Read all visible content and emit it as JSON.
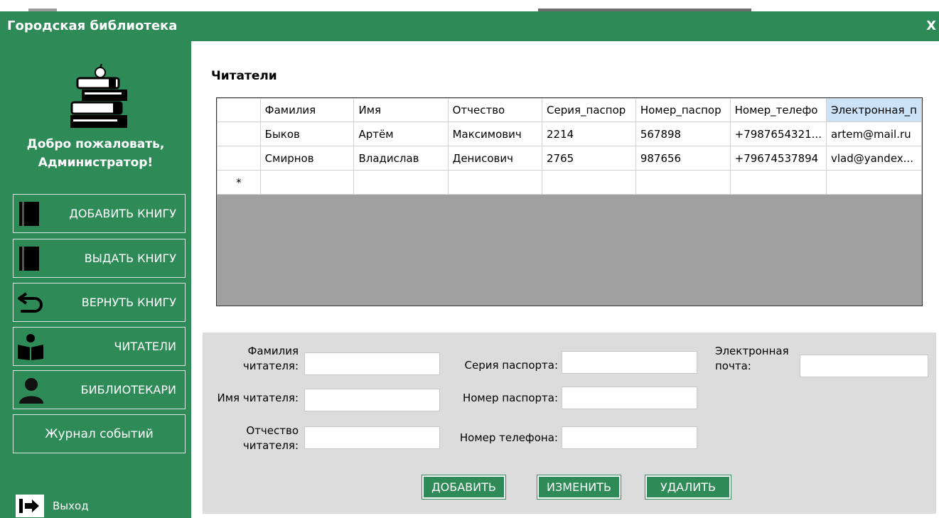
{
  "window": {
    "title": "Городская библиотека",
    "close_label": "X"
  },
  "sidebar": {
    "welcome_line1": "Добро пожаловать,",
    "welcome_line2": "Администратор!",
    "buttons": [
      {
        "label": "ДОБАВИТЬ КНИГУ",
        "icon": "book-icon"
      },
      {
        "label": "ВЫДАТЬ КНИГУ",
        "icon": "book-icon"
      },
      {
        "label": "ВЕРНУТЬ КНИГУ",
        "icon": "return-arrow-icon"
      },
      {
        "label": "ЧИТАТЕЛИ",
        "icon": "reader-icon"
      },
      {
        "label": "БИБЛИОТЕКАРИ",
        "icon": "user-icon"
      },
      {
        "label": "Журнал событий"
      }
    ],
    "exit_label": "Выход"
  },
  "main": {
    "section_title": "Читатели",
    "grid": {
      "columns": [
        "Фамилия",
        "Имя",
        "Отчество",
        "Серия_паспор",
        "Номер_паспор",
        "Номер_телефо",
        "Электронная_п"
      ],
      "rows": [
        [
          "Быков",
          "Артём",
          "Максимович",
          "2214",
          "567898",
          "+7987654321...",
          "artem@mail.ru"
        ],
        [
          "Смирнов",
          "Владислав",
          "Денисович",
          "2765",
          "987656",
          "+79674537894",
          "vlad@yandex..."
        ]
      ],
      "new_row_marker": "*"
    },
    "form": {
      "surname_label_1": "Фамилия",
      "surname_label_2": "читателя:",
      "name_label": "Имя читателя:",
      "patronymic_label_1": "Отчество",
      "patronymic_label_2": "читателя:",
      "passport_series_label": "Серия паспорта:",
      "passport_number_label": "Номер паспорта:",
      "phone_label": "Номер телефона:",
      "email_label_1": "Электронная",
      "email_label_2": "почта:",
      "surname_value": "",
      "name_value": "",
      "patronymic_value": "",
      "passport_series_value": "",
      "passport_number_value": "",
      "phone_value": "",
      "email_value": ""
    },
    "actions": {
      "add": "ДОБАВИТЬ",
      "edit": "ИЗМЕНИТЬ",
      "delete": "УДАЛИТЬ"
    }
  },
  "colors": {
    "accent": "#2e8b57",
    "panel": "#dcdcdc",
    "grid_empty": "#a0a0a0",
    "header_highlight": "#cce3f7"
  }
}
